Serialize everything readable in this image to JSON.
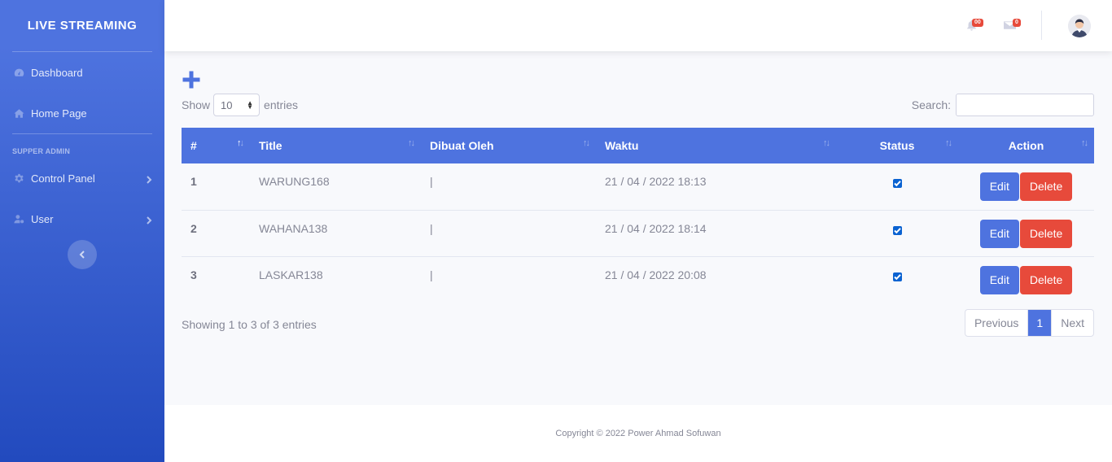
{
  "sidebar": {
    "brand": "LIVE STREAMING",
    "items": [
      {
        "label": "Dashboard",
        "icon": "tachometer-icon"
      },
      {
        "label": "Home Page",
        "icon": "home-icon"
      }
    ],
    "heading": "SUPPER ADMIN",
    "admin_items": [
      {
        "label": "Control Panel",
        "icon": "cog-icon"
      },
      {
        "label": "User",
        "icon": "user-cog-icon"
      }
    ]
  },
  "topbar": {
    "alerts_count": "00",
    "messages_count": "0"
  },
  "toolbar": {
    "show_label": "Show",
    "entries_value": "10",
    "entries_label": "entries",
    "search_label": "Search:"
  },
  "table": {
    "columns": [
      "#",
      "Title",
      "Dibuat Oleh",
      "Waktu",
      "Status",
      "Action"
    ],
    "rows": [
      {
        "num": "1",
        "title": "WARUNG168",
        "by": "|",
        "time": "21 / 04 / 2022 18:13",
        "status": true
      },
      {
        "num": "2",
        "title": "WAHANA138",
        "by": "|",
        "time": "21 / 04 / 2022 18:14",
        "status": true
      },
      {
        "num": "3",
        "title": "LASKAR138",
        "by": "|",
        "time": "21 / 04 / 2022 20:08",
        "status": true
      }
    ],
    "edit_label": "Edit",
    "delete_label": "Delete"
  },
  "footer_info": "Showing 1 to 3 of 3 entries",
  "pagination": {
    "previous": "Previous",
    "page": "1",
    "next": "Next"
  },
  "copyright": "Copyright © 2022 Power Ahmad Sofuwan",
  "colors": {
    "primary": "#4e73df",
    "danger": "#e74a3b"
  }
}
